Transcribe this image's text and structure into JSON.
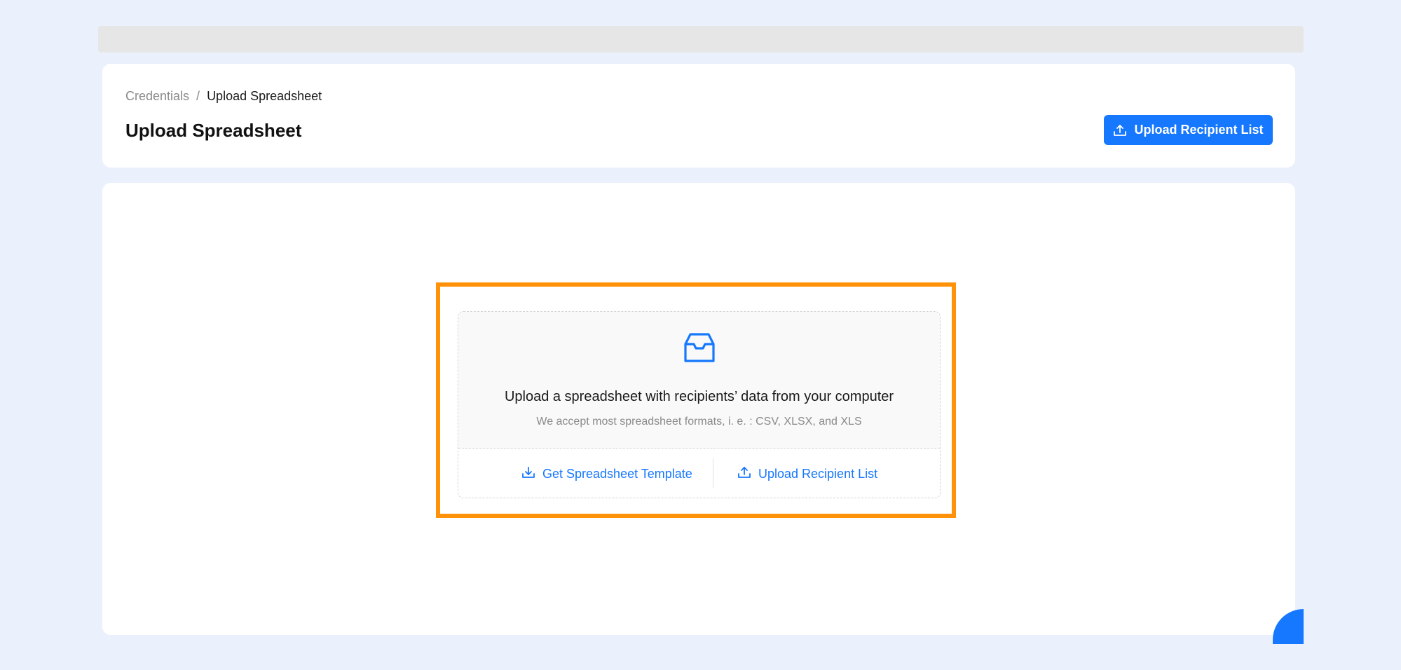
{
  "breadcrumb": {
    "parent": "Credentials",
    "separator": "/",
    "current": "Upload Spreadsheet"
  },
  "header": {
    "title": "Upload Spreadsheet",
    "upload_button_label": "Upload Recipient List",
    "upload_button_icon": "upload-icon"
  },
  "dropzone": {
    "icon": "inbox-icon",
    "title": "Upload a spreadsheet with recipients’ data from your computer",
    "hint": "We accept most spreadsheet formats, i. e. : CSV, XLSX, and XLS",
    "actions": [
      {
        "label": "Get Spreadsheet Template",
        "icon": "download-icon"
      },
      {
        "label": "Upload Recipient List",
        "icon": "upload-icon"
      }
    ]
  },
  "colors": {
    "accent": "#1677ff",
    "highlight": "#ff9208",
    "background": "#eaf1fd"
  }
}
